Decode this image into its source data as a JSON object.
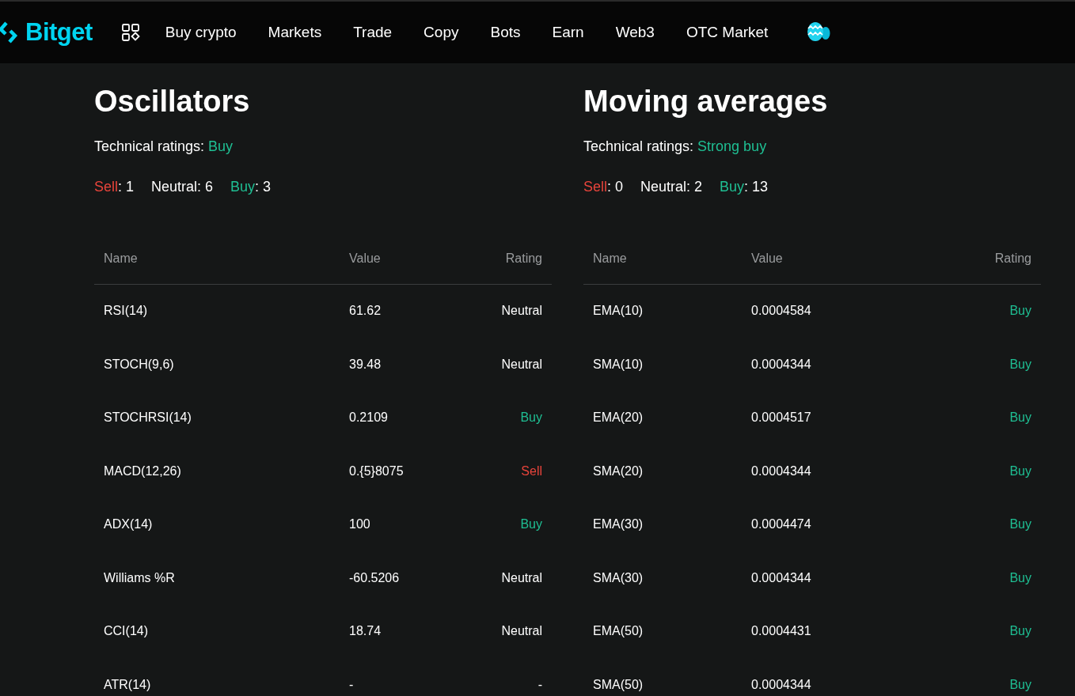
{
  "nav": {
    "logo": "Bitget",
    "items": [
      "Buy crypto",
      "Markets",
      "Trade",
      "Copy",
      "Bots",
      "Earn",
      "Web3",
      "OTC Market"
    ]
  },
  "panels": [
    {
      "title": "Oscillators",
      "ratings_label": "Technical ratings:",
      "rating": {
        "text": "Buy",
        "kind": "buy"
      },
      "counts": [
        {
          "label": "Sell",
          "kind": "sell",
          "separator": ":",
          "value": "1"
        },
        {
          "label": "Neutral",
          "kind": "neutral",
          "separator": ":",
          "value": "6"
        },
        {
          "label": "Buy",
          "kind": "buy",
          "separator": ":",
          "value": "3"
        }
      ],
      "columns": [
        "Name",
        "Value",
        "Rating"
      ],
      "rows": [
        {
          "name": "RSI(14)",
          "value": "61.62",
          "rating": "Neutral",
          "kind": "neutral"
        },
        {
          "name": "STOCH(9,6)",
          "value": "39.48",
          "rating": "Neutral",
          "kind": "neutral"
        },
        {
          "name": "STOCHRSI(14)",
          "value": "0.2109",
          "rating": "Buy",
          "kind": "buy"
        },
        {
          "name": "MACD(12,26)",
          "value": "0.{5}8075",
          "rating": "Sell",
          "kind": "sell"
        },
        {
          "name": "ADX(14)",
          "value": "100",
          "rating": "Buy",
          "kind": "buy"
        },
        {
          "name": "Williams %R",
          "value": "-60.5206",
          "rating": "Neutral",
          "kind": "neutral"
        },
        {
          "name": "CCI(14)",
          "value": "18.74",
          "rating": "Neutral",
          "kind": "neutral"
        },
        {
          "name": "ATR(14)",
          "value": "-",
          "rating": "-",
          "kind": "neutral"
        }
      ]
    },
    {
      "title": "Moving averages",
      "ratings_label": "Technical ratings:",
      "rating": {
        "text": "Strong buy",
        "kind": "buy"
      },
      "counts": [
        {
          "label": "Sell",
          "kind": "sell",
          "separator": ":",
          "value": "0"
        },
        {
          "label": "Neutral",
          "kind": "neutral",
          "separator": ":",
          "value": "2"
        },
        {
          "label": "Buy",
          "kind": "buy",
          "separator": ":",
          "value": "13"
        }
      ],
      "columns": [
        "Name",
        "Value",
        "Rating"
      ],
      "rows": [
        {
          "name": "EMA(10)",
          "value": "0.0004584",
          "rating": "Buy",
          "kind": "buy"
        },
        {
          "name": "SMA(10)",
          "value": "0.0004344",
          "rating": "Buy",
          "kind": "buy"
        },
        {
          "name": "EMA(20)",
          "value": "0.0004517",
          "rating": "Buy",
          "kind": "buy"
        },
        {
          "name": "SMA(20)",
          "value": "0.0004344",
          "rating": "Buy",
          "kind": "buy"
        },
        {
          "name": "EMA(30)",
          "value": "0.0004474",
          "rating": "Buy",
          "kind": "buy"
        },
        {
          "name": "SMA(30)",
          "value": "0.0004344",
          "rating": "Buy",
          "kind": "buy"
        },
        {
          "name": "EMA(50)",
          "value": "0.0004431",
          "rating": "Buy",
          "kind": "buy"
        },
        {
          "name": "SMA(50)",
          "value": "0.0004344",
          "rating": "Buy",
          "kind": "buy"
        }
      ]
    }
  ]
}
